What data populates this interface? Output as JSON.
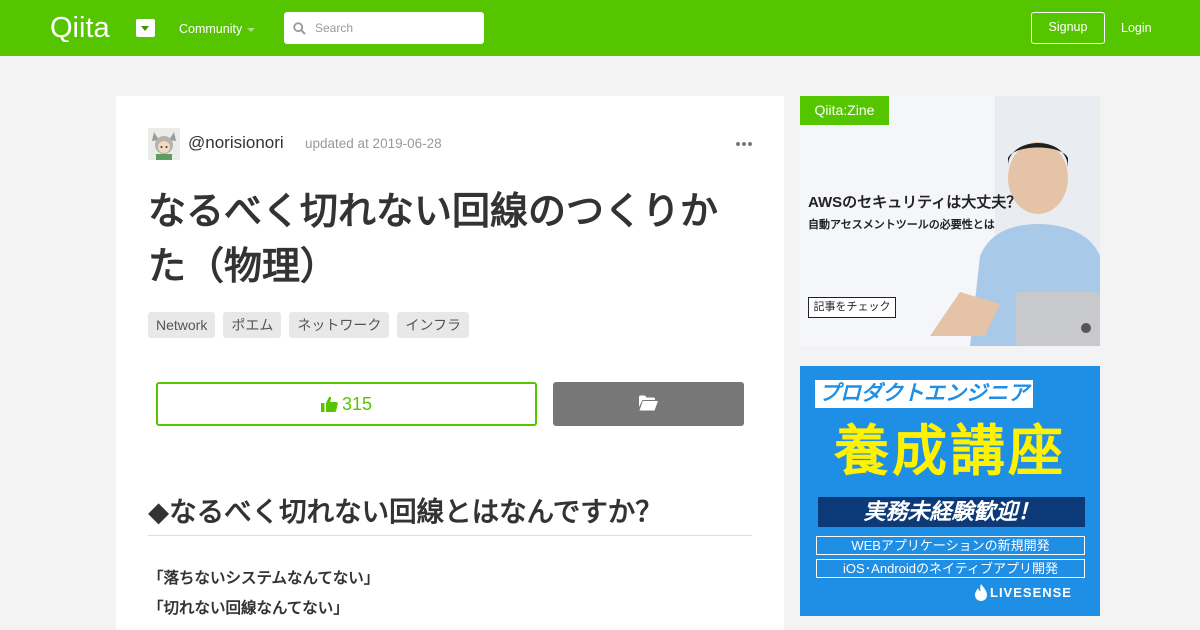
{
  "header": {
    "logo": "Qiita",
    "community_label": "Community",
    "search_placeholder": "Search",
    "signup_label": "Signup",
    "login_label": "Login"
  },
  "article": {
    "username": "@norisionori",
    "updated": "updated at 2019-06-28",
    "title": "なるべく切れない回線のつくりかた（物理）",
    "tags": [
      "Network",
      "ポエム",
      "ネットワーク",
      "インフラ"
    ],
    "likes": "315",
    "section_heading": "◆なるべく切れない回線とはなんですか？",
    "lines": [
      "「落ちないシステムなんてない」",
      "「切れない回線なんてない」"
    ]
  },
  "ads": {
    "zine": {
      "badge": "Qiita:Zine",
      "headline": "AWSのセキュリティは大丈夫？",
      "subline": "自動アセスメントツールの必要性とは",
      "button": "記事をチェック"
    },
    "livesense": {
      "top": "プロダクトエンジニア",
      "big": "養成講座",
      "mid": "実務未経験歓迎！",
      "line1": "WEBアプリケーションの新規開発",
      "line2": "iOS･Androidのネイティブアプリ開発",
      "brand": "LIVESENSE"
    }
  },
  "colors": {
    "brand_green": "#55c500",
    "ad_blue": "#1f8fe6",
    "ad_yellow": "#fff200"
  }
}
